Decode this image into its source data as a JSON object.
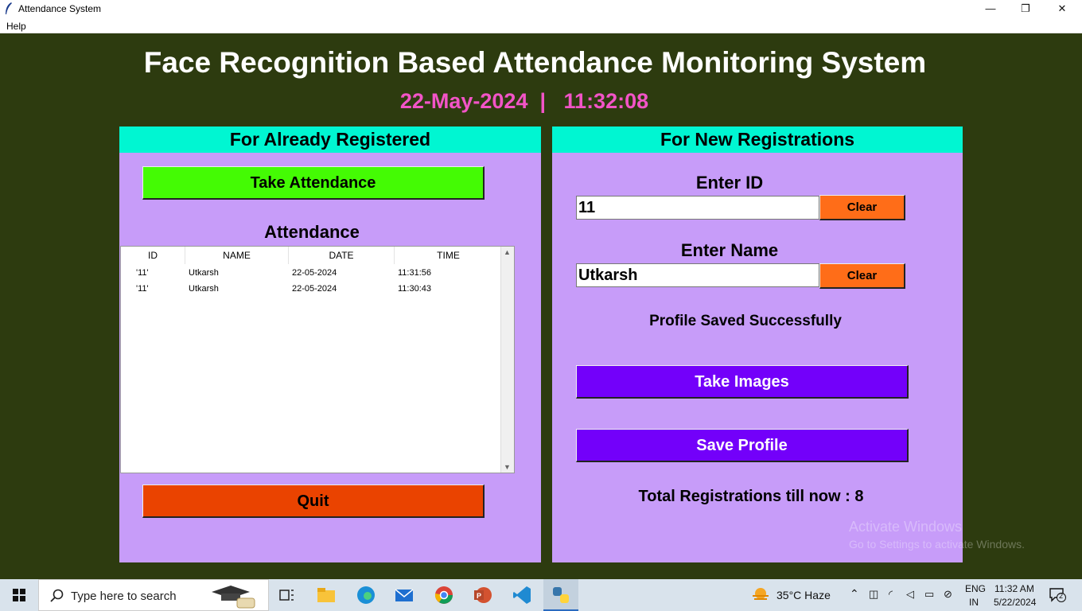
{
  "window": {
    "title": "Attendance System",
    "minimize": "—",
    "restore": "❐",
    "close": "✕"
  },
  "menu": {
    "help": "Help"
  },
  "header": {
    "title": "Face Recognition Based Attendance Monitoring System",
    "datetime": "22-May-2024  |   11:32:08"
  },
  "left_panel": {
    "heading": "For Already Registered",
    "take_attendance": "Take Attendance",
    "attendance_label": "Attendance",
    "columns": [
      "ID",
      "NAME",
      "DATE",
      "TIME"
    ],
    "rows": [
      {
        "id": "'11'",
        "name": "Utkarsh",
        "date": "22-05-2024",
        "time": "11:31:56"
      },
      {
        "id": "'11'",
        "name": "Utkarsh",
        "date": "22-05-2024",
        "time": "11:30:43"
      }
    ],
    "quit": "Quit"
  },
  "right_panel": {
    "heading": "For New Registrations",
    "id_label": "Enter ID",
    "id_value": "11",
    "name_label": "Enter Name",
    "name_value": "Utkarsh",
    "clear": "Clear",
    "status": "Profile Saved Successfully",
    "take_images": "Take Images",
    "save_profile": "Save Profile",
    "total": "Total Registrations till now  : 8"
  },
  "watermark": {
    "line1": "Activate Windows",
    "line2": "Go to Settings to activate Windows."
  },
  "taskbar": {
    "search_placeholder": "Type here to search",
    "weather": "35°C  Haze",
    "lang1": "ENG",
    "lang2": "IN",
    "time": "11:32 AM",
    "date": "5/22/2024",
    "notifications": "2"
  }
}
